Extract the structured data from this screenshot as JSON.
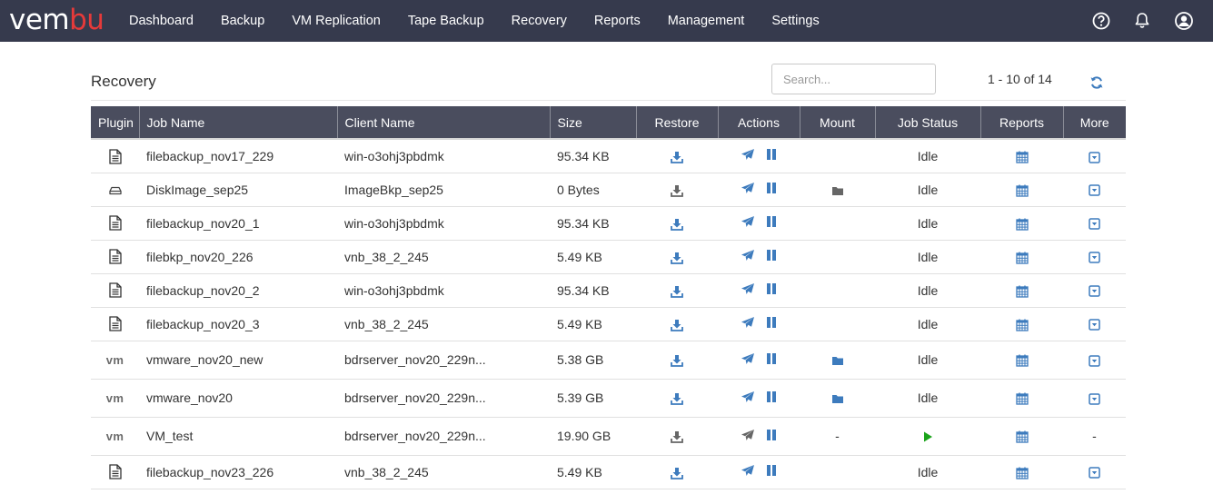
{
  "brand": {
    "logo_part1": "vem",
    "logo_part2": "bu"
  },
  "nav": {
    "items": [
      {
        "label": "Dashboard"
      },
      {
        "label": "Backup"
      },
      {
        "label": "VM Replication"
      },
      {
        "label": "Tape Backup"
      },
      {
        "label": "Recovery"
      },
      {
        "label": "Reports"
      },
      {
        "label": "Management"
      },
      {
        "label": "Settings"
      }
    ]
  },
  "page": {
    "title": "Recovery",
    "search_placeholder": "Search...",
    "pager": "1 - 10 of 14"
  },
  "colors": {
    "nav_bg": "#363a4d",
    "header_bg": "#4a4d5e",
    "accent_blue": "#3d7bbd",
    "gray_icon": "#666666",
    "play_green": "#1aa31a",
    "logo_red": "#e63a3a"
  },
  "table": {
    "columns": [
      "Plugin",
      "Job Name",
      "Client Name",
      "Size",
      "Restore",
      "Actions",
      "Mount",
      "Job Status",
      "Reports",
      "More"
    ],
    "rows": [
      {
        "plugin": "file",
        "job": "filebackup_nov17_229",
        "client": "win-o3ohj3pbdmk",
        "size": "95.34 KB",
        "restore": "blue",
        "actions": "blue",
        "mount": "",
        "status": "Idle",
        "status_type": "text",
        "more": "icon"
      },
      {
        "plugin": "disk",
        "job": "DiskImage_sep25",
        "client": "ImageBkp_sep25",
        "size": "0 Bytes",
        "restore": "gray",
        "actions": "blue",
        "mount": "gray-folder",
        "status": "Idle",
        "status_type": "text",
        "more": "icon"
      },
      {
        "plugin": "file",
        "job": "filebackup_nov20_1",
        "client": "win-o3ohj3pbdmk",
        "size": "95.34 KB",
        "restore": "blue",
        "actions": "blue",
        "mount": "",
        "status": "Idle",
        "status_type": "text",
        "more": "icon"
      },
      {
        "plugin": "file",
        "job": "filebkp_nov20_226",
        "client": "vnb_38_2_245",
        "size": "5.49 KB",
        "restore": "blue",
        "actions": "blue",
        "mount": "",
        "status": "Idle",
        "status_type": "text",
        "more": "icon"
      },
      {
        "plugin": "file",
        "job": "filebackup_nov20_2",
        "client": "win-o3ohj3pbdmk",
        "size": "95.34 KB",
        "restore": "blue",
        "actions": "blue",
        "mount": "",
        "status": "Idle",
        "status_type": "text",
        "more": "icon"
      },
      {
        "plugin": "file",
        "job": "filebackup_nov20_3",
        "client": "vnb_38_2_245",
        "size": "5.49 KB",
        "restore": "blue",
        "actions": "blue",
        "mount": "",
        "status": "Idle",
        "status_type": "text",
        "more": "icon"
      },
      {
        "plugin": "vm",
        "plugin_label": "vm",
        "job": "vmware_nov20_new",
        "client": "bdrserver_nov20_229n...",
        "size": "5.38 GB",
        "restore": "blue",
        "actions": "blue",
        "mount": "blue-folder",
        "status": "Idle",
        "status_type": "text",
        "more": "icon"
      },
      {
        "plugin": "vm",
        "plugin_label": "vm",
        "job": "vmware_nov20",
        "client": "bdrserver_nov20_229n...",
        "size": "5.39 GB",
        "restore": "blue",
        "actions": "blue",
        "mount": "blue-folder",
        "status": "Idle",
        "status_type": "text",
        "more": "icon"
      },
      {
        "plugin": "vm",
        "plugin_label": "vm",
        "job": "VM_test",
        "client": "bdrserver_nov20_229n...",
        "size": "19.90 GB",
        "restore": "gray",
        "actions": "gray",
        "mount": "dash",
        "mount_text": "-",
        "status": "",
        "status_type": "play",
        "more": "dash",
        "more_text": "-"
      },
      {
        "plugin": "file",
        "job": "filebackup_nov23_226",
        "client": "vnb_38_2_245",
        "size": "5.49 KB",
        "restore": "blue",
        "actions": "blue",
        "mount": "",
        "status": "Idle",
        "status_type": "text",
        "more": "icon"
      }
    ]
  }
}
